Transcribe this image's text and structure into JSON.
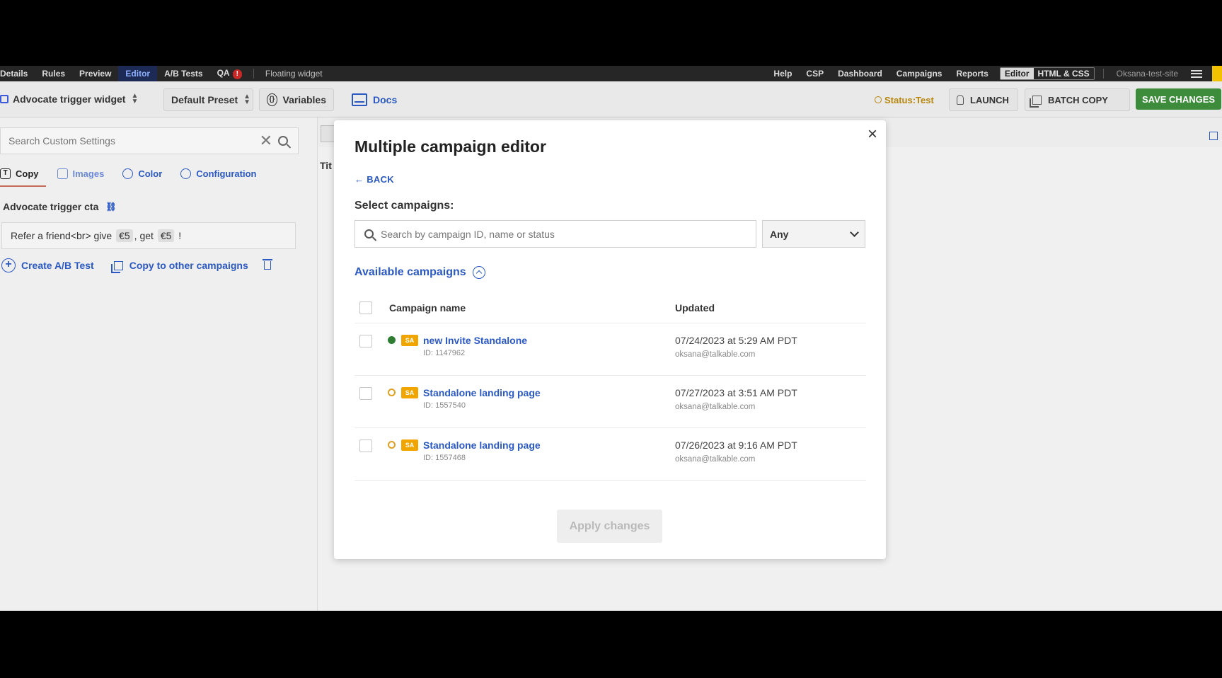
{
  "topnav": {
    "left_items": [
      "Details",
      "Rules",
      "Preview",
      "Editor",
      "A/B Tests",
      "QA"
    ],
    "active": "Editor",
    "qa_badge": "!",
    "widget_name": "Floating widget",
    "right_items": [
      "Help",
      "CSP",
      "Dashboard",
      "Campaigns",
      "Reports"
    ],
    "mode_toggle": [
      "Editor",
      "HTML & CSS"
    ],
    "site": "Oksana-test-site"
  },
  "toolbar": {
    "widget_select": "Advocate trigger widget",
    "preset_select": "Default Preset",
    "variables_label": "Variables",
    "docs_label": "Docs",
    "status_label": "Status:Test",
    "launch_label": "LAUNCH",
    "batch_copy_label": "BATCH COPY",
    "save_label": "SAVE CHANGES"
  },
  "left_panel": {
    "search_placeholder": "Search Custom Settings",
    "tabs": [
      "Copy",
      "Images",
      "Color",
      "Configuration"
    ],
    "active_tab": "Copy",
    "field_label": "Advocate trigger cta",
    "field_value_parts": [
      "Refer a friend<br> give ",
      "€5",
      ", get ",
      "€5",
      " !"
    ],
    "create_ab_label": "Create A/B Test",
    "copy_other_label": "Copy to other campaigns"
  },
  "canvas": {
    "title_fragment": "Tit"
  },
  "modal": {
    "title": "Multiple campaign editor",
    "back_label": "← BACK",
    "select_label": "Select campaigns:",
    "search_placeholder": "Search by campaign ID, name or status",
    "filter_value": "Any",
    "available_label": "Available campaigns",
    "columns": {
      "name": "Campaign name",
      "updated": "Updated"
    },
    "campaigns": [
      {
        "status": "live",
        "badge": "SA",
        "name": "new Invite Standalone",
        "id": "ID: 1147962",
        "updated": "07/24/2023 at 5:29 AM PDT",
        "email": "oksana@talkable.com"
      },
      {
        "status": "test",
        "badge": "SA",
        "name": "Standalone landing page",
        "id": "ID: 1557540",
        "updated": "07/27/2023 at 3:51 AM PDT",
        "email": "oksana@talkable.com"
      },
      {
        "status": "test",
        "badge": "SA",
        "name": "Standalone landing page",
        "id": "ID: 1557468",
        "updated": "07/26/2023 at 9:16 AM PDT",
        "email": "oksana@talkable.com"
      }
    ],
    "apply_label": "Apply changes",
    "close_glyph": "×"
  },
  "colors": {
    "accent": "#2b59c3",
    "save_green": "#3c8c3c",
    "status_test": "#b8860b",
    "sa_badge": "#f0a500",
    "live_dot": "#2e7d32"
  }
}
